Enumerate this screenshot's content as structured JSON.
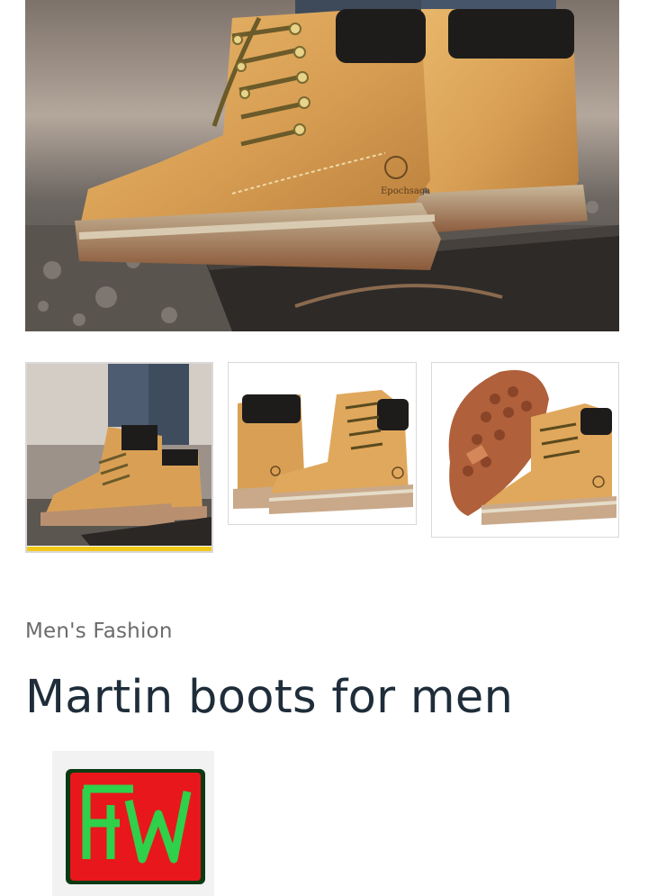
{
  "gallery": {
    "main_image_icon": "boot-photo",
    "thumbnails": [
      {
        "name": "thumbnail-1",
        "active": true
      },
      {
        "name": "thumbnail-2",
        "active": false
      },
      {
        "name": "thumbnail-3",
        "active": false
      }
    ],
    "active_indicator_color": "#f2c81b",
    "boot_brand_text": "Epochsaga"
  },
  "product": {
    "category": "Men's Fashion",
    "title": "Martin boots for men"
  },
  "vendor_logo": {
    "icon": "fw-logo",
    "text": "FW",
    "colors": {
      "background": "#e8171b",
      "letters": "#2fd04a",
      "frame": "#0b3a12"
    }
  }
}
